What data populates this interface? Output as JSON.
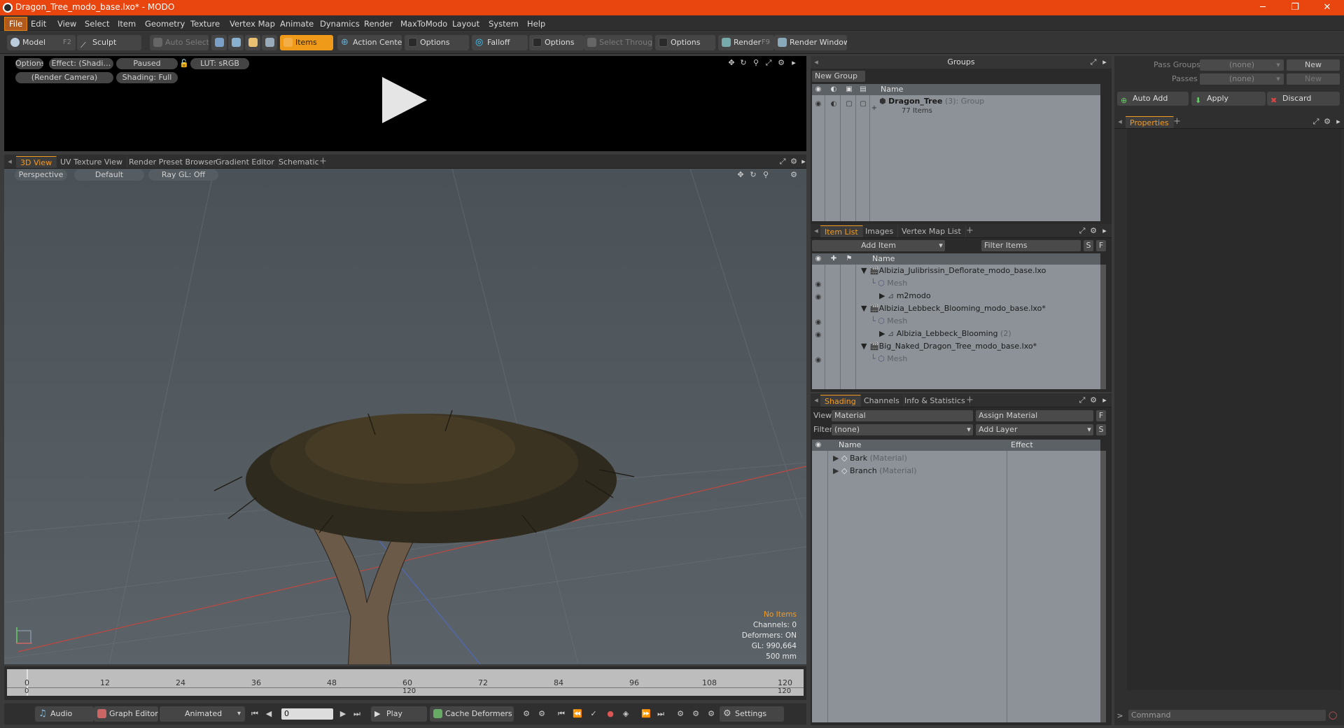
{
  "window": {
    "title": "Dragon_Tree_modo_base.lxo* - MODO",
    "min": "─",
    "max": "❐",
    "close": "✕"
  },
  "menu": [
    "File",
    "Edit",
    "View",
    "Select",
    "Item",
    "Geometry",
    "Texture",
    "Vertex Map",
    "Animate",
    "Dynamics",
    "Render",
    "MaxToModo",
    "Layout",
    "System",
    "Help"
  ],
  "toolbar": {
    "model": "Model",
    "model_key": "F2",
    "sculpt": "Sculpt",
    "auto_select": "Auto Select",
    "items": "Items",
    "action_center": "Action Center",
    "options1": "Options",
    "falloff": "Falloff",
    "options2": "Options",
    "select_through": "Select Through",
    "options3": "Options",
    "render": "Render",
    "render_key": "F9",
    "render_window": "Render Window"
  },
  "preview": {
    "options": "Options",
    "effect": "Effect: (Shadi…",
    "paused": "Paused",
    "lut": "LUT: sRGB",
    "camera": "(Render Camera)",
    "shading": "Shading: Full"
  },
  "viewtabs": [
    "3D View",
    "UV Texture View",
    "Render Preset Browser",
    "Gradient Editor",
    "Schematic"
  ],
  "viewport": {
    "perspective": "Perspective",
    "default": "Default",
    "raygl": "Ray GL: Off",
    "info": {
      "items": "No Items",
      "channels": "Channels: 0",
      "deformers": "Deformers: ON",
      "gl": "GL: 990,664",
      "scale": "500 mm"
    }
  },
  "timeline": {
    "ticks": [
      "0",
      "12",
      "24",
      "36",
      "48",
      "60",
      "72",
      "84",
      "96",
      "108",
      "120"
    ],
    "sub_ticks": [
      "0",
      "120",
      "120"
    ]
  },
  "bottombar": {
    "audio": "Audio",
    "graph_editor": "Graph Editor",
    "animated": "Animated",
    "frame": "0",
    "play": "Play",
    "cache": "Cache Deformers",
    "settings": "Settings"
  },
  "groups": {
    "title": "Groups",
    "new_group": "New Group",
    "col_name": "Name",
    "row_name": "Dragon_Tree",
    "row_count": "(3)",
    "row_type": ": Group",
    "row_items": "77 Items"
  },
  "itemlist": {
    "tabs": [
      "Item List",
      "Images",
      "Vertex Map List"
    ],
    "add_item": "Add Item",
    "filter": "Filter Items",
    "s": "S",
    "f": "F",
    "col_name": "Name",
    "rows": [
      {
        "label": "Albizia_Julibrissin_Deflorate_modo_base.lxo",
        "type": "scene"
      },
      {
        "label": "Mesh",
        "type": "mesh"
      },
      {
        "label": "m2modo",
        "type": "locator"
      },
      {
        "label": "Albizia_Lebbeck_Blooming_modo_base.lxo*",
        "type": "scene"
      },
      {
        "label": "Mesh",
        "type": "mesh"
      },
      {
        "label": "Albizia_Lebbeck_Blooming",
        "count": "(2)",
        "type": "locator"
      },
      {
        "label": "Big_Naked_Dragon_Tree_modo_base.lxo*",
        "type": "scene"
      },
      {
        "label": "Mesh",
        "type": "mesh"
      }
    ]
  },
  "shading": {
    "tabs": [
      "Shading",
      "Channels",
      "Info & Statistics"
    ],
    "view_label": "View",
    "view_value": "Material",
    "assign": "Assign Material",
    "f": "F",
    "filter_label": "Filter",
    "filter_value": "(none)",
    "add_layer": "Add Layer",
    "s": "S",
    "col_name": "Name",
    "col_effect": "Effect",
    "rows": [
      {
        "name": "Bark",
        "type": "(Material)"
      },
      {
        "name": "Branch",
        "type": "(Material)"
      }
    ]
  },
  "properties": {
    "pass_groups": "Pass Groups",
    "pass_groups_value": "(none)",
    "new1": "New",
    "passes": "Passes",
    "passes_value": "(none)",
    "new2": "New",
    "auto_add": "Auto Add",
    "apply": "Apply",
    "discard": "Discard",
    "tab": "Properties",
    "command": "Command"
  }
}
